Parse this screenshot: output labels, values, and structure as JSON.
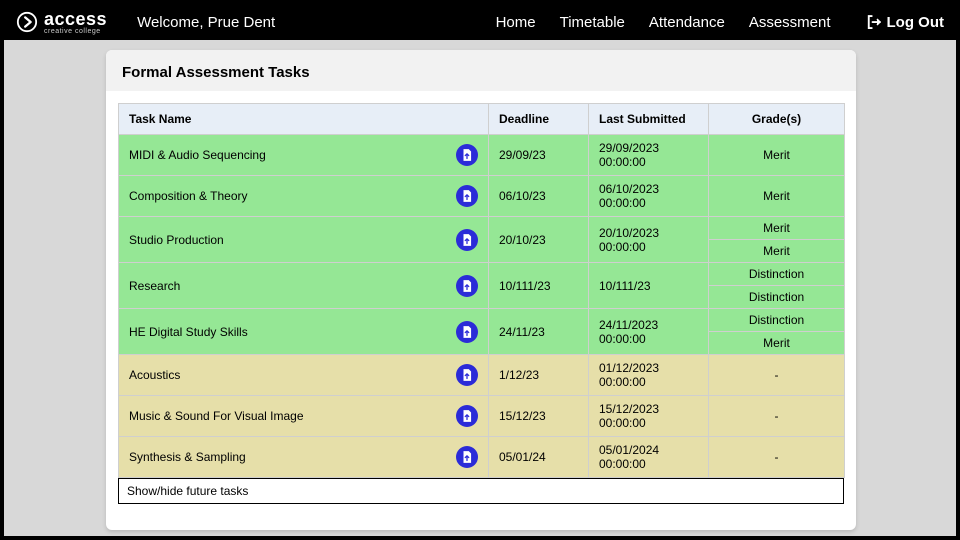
{
  "logo": {
    "main": "access",
    "sub": "creative college"
  },
  "welcome": "Welcome, Prue Dent",
  "nav": {
    "home": "Home",
    "timetable": "Timetable",
    "attendance": "Attendance",
    "assessment": "Assessment",
    "logout": "Log Out"
  },
  "card": {
    "title": "Formal Assessment Tasks"
  },
  "columns": {
    "task": "Task Name",
    "deadline": "Deadline",
    "submitted": "Last Submitted",
    "grade": "Grade(s)"
  },
  "rows": [
    {
      "task": "MIDI & Audio Sequencing",
      "deadline": "29/09/23",
      "submitted": "29/09/2023 00:00:00",
      "grades": [
        "Merit"
      ],
      "status": "green"
    },
    {
      "task": "Composition & Theory",
      "deadline": "06/10/23",
      "submitted": "06/10/2023 00:00:00",
      "grades": [
        "Merit"
      ],
      "status": "green"
    },
    {
      "task": "Studio Production",
      "deadline": "20/10/23",
      "submitted": "20/10/2023 00:00:00",
      "grades": [
        "Merit",
        "Merit"
      ],
      "status": "green"
    },
    {
      "task": "Research",
      "deadline": "10/111/23",
      "submitted": "10/111/23",
      "grades": [
        "Distinction",
        "Distinction"
      ],
      "status": "green"
    },
    {
      "task": "HE Digital Study Skills",
      "deadline": "24/11/23",
      "submitted": "24/11/2023 00:00:00",
      "grades": [
        "Distinction",
        "Merit"
      ],
      "status": "green"
    },
    {
      "task": "Acoustics",
      "deadline": "1/12/23",
      "submitted": "01/12/2023 00:00:00",
      "grades": [
        "-"
      ],
      "status": "tan"
    },
    {
      "task": "Music & Sound For Visual Image",
      "deadline": "15/12/23",
      "submitted": "15/12/2023 00:00:00",
      "grades": [
        "-"
      ],
      "status": "tan"
    },
    {
      "task": "Synthesis & Sampling",
      "deadline": "05/01/24",
      "submitted": "05/01/2024 00:00:00",
      "grades": [
        "-"
      ],
      "status": "tan"
    }
  ],
  "toggle": "Show/hide future tasks"
}
